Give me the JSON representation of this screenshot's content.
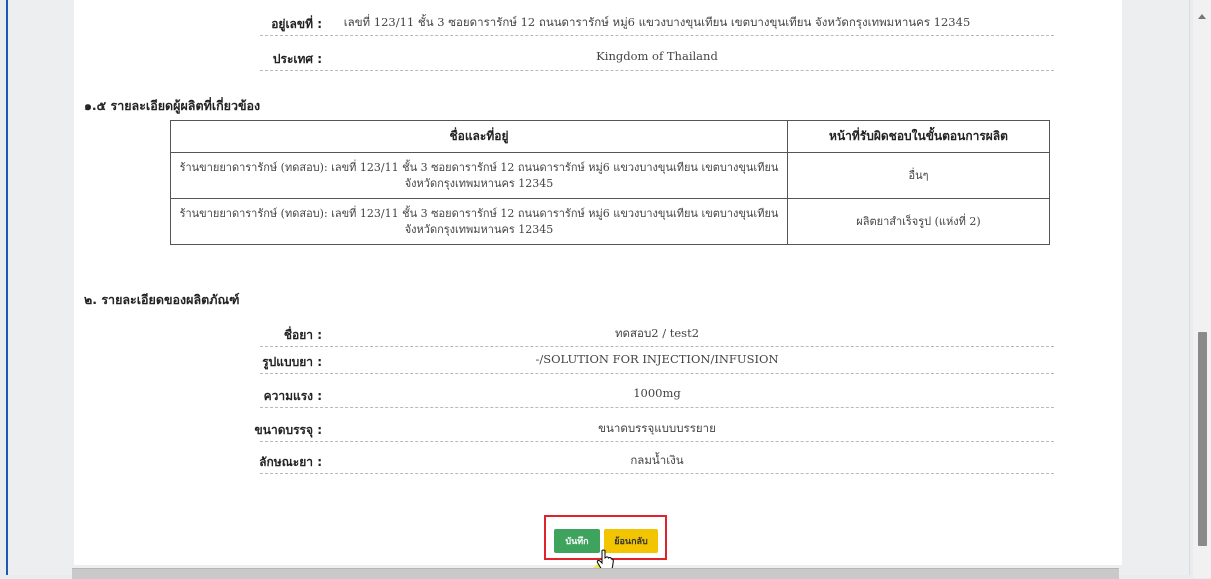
{
  "address_block": {
    "address_label": "อยู่เลขที่ :",
    "address_value": "เลขที่ 123/11 ชั้น 3 ซอยดารารักษ์ 12 ถนนดารารักษ์ หมู่6 แขวงบางขุนเทียน เขตบางขุนเทียน จังหวัดกรุงเทพมหานคร 12345",
    "country_label": "ประเทศ :",
    "country_value": "Kingdom of Thailand"
  },
  "section_1_5": {
    "title": "๑.๕ รายละเอียดผู้ผลิตที่เกี่ยวข้อง",
    "headers": [
      "ชื่อและที่อยู่",
      "หน้าที่รับผิดชอบในขั้นตอนการผลิต"
    ],
    "rows": [
      {
        "name_line1": "ร้านขายยาดารารักษ์ (ทดสอบ): เลขที่ 123/11 ชั้น 3 ซอยดารารักษ์ 12 ถนนดารารักษ์ หมู่6 แขวงบางขุนเทียน เขตบางขุนเทียน",
        "name_line2": "จังหวัดกรุงเทพมหานคร 12345",
        "role": "อื่นๆ"
      },
      {
        "name_line1": "ร้านขายยาดารารักษ์ (ทดสอบ): เลขที่ 123/11 ชั้น 3 ซอยดารารักษ์ 12 ถนนดารารักษ์ หมู่6 แขวงบางขุนเทียน เขตบางขุนเทียน",
        "name_line2": "จังหวัดกรุงเทพมหานคร 12345",
        "role": "ผลิตยาสำเร็จรูป (แห่งที่ 2)"
      }
    ]
  },
  "section_2": {
    "title": "๒. รายละเอียดของผลิตภัณฑ์",
    "fields": [
      {
        "label": "ชื่อยา :",
        "value": "ทดสอบ2 / test2"
      },
      {
        "label": "รูปแบบยา :",
        "value": "-/SOLUTION FOR INJECTION/INFUSION"
      },
      {
        "label": "ความแรง :",
        "value": "1000mg"
      },
      {
        "label": "ขนาดบรรจุ :",
        "value": "ขนาดบรรจุแบบบรรยาย"
      },
      {
        "label": "ลักษณะยา :",
        "value": "กลมน้ำเงิน"
      }
    ]
  },
  "actions": {
    "save_label": "บันทึก",
    "back_label": "ย้อนกลับ"
  },
  "colors": {
    "save": "#3da35d",
    "back": "#f3c400",
    "highlight": "#e0222b",
    "frame": "#1e57b5"
  }
}
